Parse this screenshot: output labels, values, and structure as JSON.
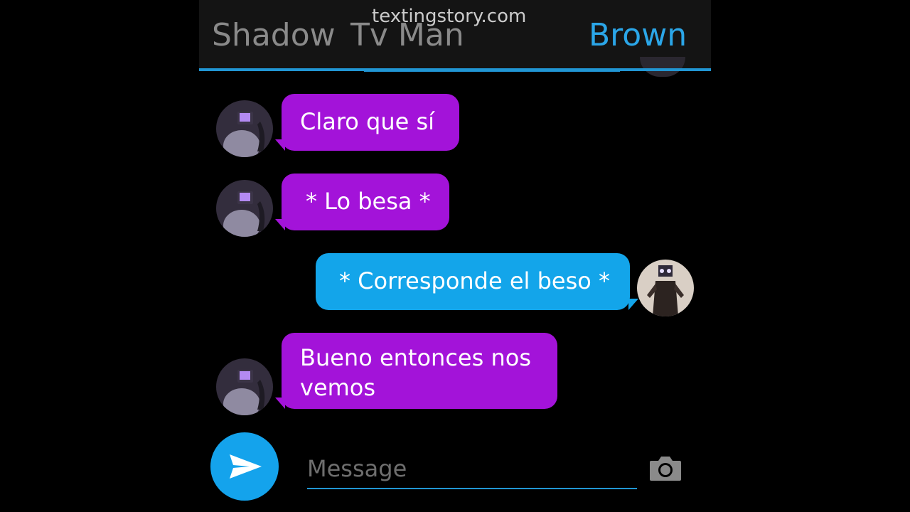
{
  "header": {
    "tabs": [
      {
        "label": "Shadow",
        "active": false
      },
      {
        "label": "Tv Man",
        "active": false
      },
      {
        "label": "Brown",
        "active": true
      }
    ],
    "watermark": "textingstory.com"
  },
  "messages": [
    {
      "sender": "Tv Man",
      "side": "left",
      "text": "Claro que sí"
    },
    {
      "sender": "Tv Man",
      "side": "left",
      "text": "* Lo besa *"
    },
    {
      "sender": "Brown",
      "side": "right",
      "text": "* Corresponde el beso *"
    },
    {
      "sender": "Tv Man",
      "side": "left",
      "text": "Bueno entonces nos vemos"
    }
  ],
  "composer": {
    "placeholder": "Message",
    "send_icon": "send-icon",
    "camera_icon": "camera-icon"
  },
  "colors": {
    "accent": "#2196d3",
    "left_bubble": "#a313d9",
    "right_bubble": "#13a5ea",
    "header_bg": "#141414"
  }
}
